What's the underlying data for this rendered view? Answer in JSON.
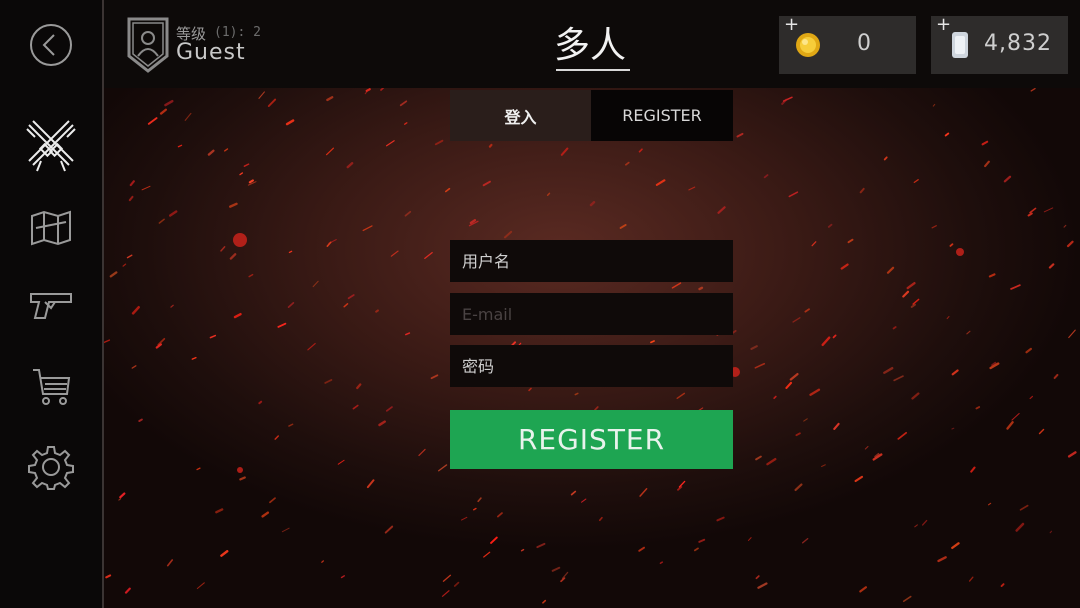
{
  "header": {
    "rank_label": "等级",
    "rank_value": "(1): 2",
    "player_name": "Guest",
    "title": "多人"
  },
  "currency": {
    "coins": {
      "plus": "+",
      "amount": "0",
      "icon": "gold-coin-icon"
    },
    "gems": {
      "plus": "+",
      "amount": "4,832",
      "icon": "silver-card-icon"
    }
  },
  "sidebar": {
    "items": [
      {
        "icon": "back-arrow-icon"
      },
      {
        "icon": "crossed-guns-icon",
        "active": true
      },
      {
        "icon": "map-icon"
      },
      {
        "icon": "pistol-icon"
      },
      {
        "icon": "shopping-cart-icon"
      },
      {
        "icon": "gear-icon"
      }
    ]
  },
  "tabs": {
    "login_label": "登入",
    "register_label": "REGISTER"
  },
  "form": {
    "username_placeholder": "用户名",
    "email_placeholder": "E-mail",
    "password_placeholder": "密码",
    "submit_label": "REGISTER"
  },
  "colors": {
    "accent_green": "#1ea552",
    "topbar": "#0d0a09",
    "field_bg": "#0f0a09"
  }
}
